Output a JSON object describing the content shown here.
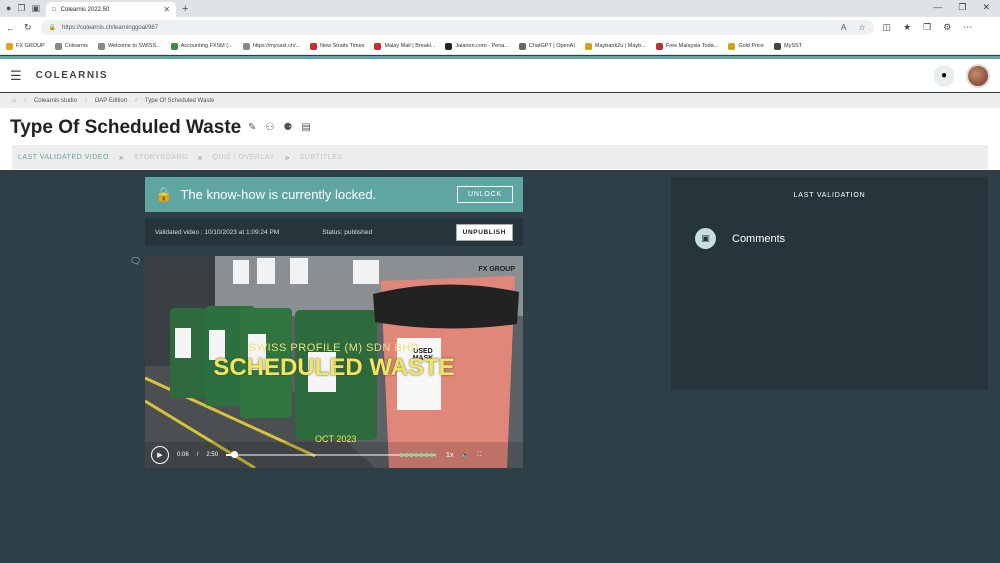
{
  "browser": {
    "tab_title": "Colearnis 2022.50",
    "url": "https://colearnis.ch/learninggoal/987",
    "bookmarks": [
      "FX GROUP",
      "Colearnis",
      "Welcome to SWISS...",
      "Accounting FXSM (...",
      "https://mycast.ch/...",
      "New Straits Times",
      "Malay Mail | Breaki...",
      "Jalanon.com - Pena...",
      "ChatGPT | OpenAI",
      "Maybank2u | Mayb...",
      "Free Malaysia Toda...",
      "Gold Price",
      "MySST"
    ],
    "bookmark_colors": [
      "#e8a020",
      "#888",
      "#888",
      "#3c8f3c",
      "#888",
      "#c0302a",
      "#c0302a",
      "#222",
      "#666",
      "#d4a017",
      "#c0302a",
      "#d4a017",
      "#444"
    ]
  },
  "app": {
    "logo": "COLEARNIS",
    "breadcrumb": [
      "Colearnis studio",
      "OAP Edition",
      "Type Of Scheduled Waste"
    ],
    "page_title": "Type Of Scheduled Waste",
    "steps": [
      {
        "label": "LAST VALIDATED VIDEO",
        "active": true
      },
      {
        "label": "STORYBOARD",
        "active": false
      },
      {
        "label": "QUIZ / OVERLAY",
        "active": false
      },
      {
        "label": "SUBTITLES",
        "active": false
      }
    ],
    "lock": {
      "message": "The know-how is currently locked.",
      "button": "UNLOCK"
    },
    "validated": {
      "text": "Validated video : 10/10/2023 at 1:09:24 PM",
      "status": "Status: published",
      "button": "UNPUBLISH"
    },
    "video": {
      "caption_line1": "SWISS PROFILE (M) SDN BHD",
      "caption_line2": "SCHEDULED WASTE",
      "caption_date": "OCT 2023",
      "brand": "FX GROUP",
      "bin_label": "USED MASK",
      "current_time": "0:06",
      "separator": "/",
      "duration": "2:50",
      "progress_fraction": 0.04,
      "rate": "1x"
    },
    "panel": {
      "title": "LAST VALIDATION",
      "comments_label": "Comments"
    },
    "colors": {
      "accent": "#5fa6a2",
      "dark_bg": "#2f3f47",
      "panel_bg": "#26343b"
    }
  }
}
